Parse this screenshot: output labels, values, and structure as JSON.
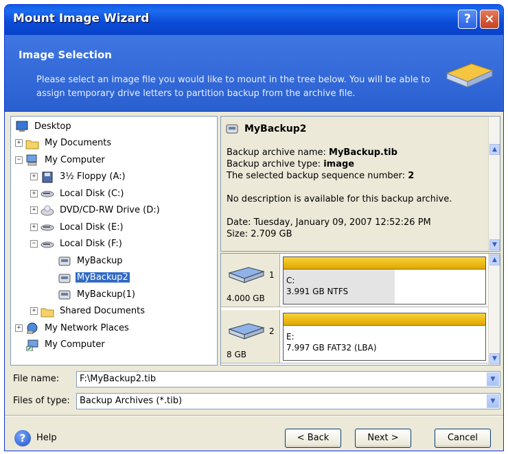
{
  "window": {
    "title": "Mount Image Wizard",
    "help_glyph": "?",
    "close_glyph": "×"
  },
  "header": {
    "title": "Image Selection",
    "description": "Please select an image file you would like to mount in the tree below. You will be able to assign temporary drive letters to partition backup from the archive file."
  },
  "tree": {
    "items": [
      {
        "label": "Desktop",
        "icon": "desktop-icon"
      },
      {
        "label": "My Documents",
        "icon": "folder-icon",
        "expander": "+"
      },
      {
        "label": "My Computer",
        "icon": "computer-icon",
        "expander": "-"
      },
      {
        "label": "3½ Floppy (A:)",
        "icon": "floppy-icon",
        "expander": "+"
      },
      {
        "label": "Local Disk (C:)",
        "icon": "hard-disk-icon",
        "expander": "+"
      },
      {
        "label": "DVD/CD-RW Drive (D:)",
        "icon": "cd-drive-icon",
        "expander": "+"
      },
      {
        "label": "Local Disk (E:)",
        "icon": "hard-disk-icon",
        "expander": "+"
      },
      {
        "label": "Local Disk (F:)",
        "icon": "hard-disk-icon",
        "expander": "-"
      },
      {
        "label": "MyBackup",
        "icon": "backup-archive-icon"
      },
      {
        "label": "MyBackup2",
        "icon": "backup-archive-icon",
        "selected": true
      },
      {
        "label": "MyBackup(1)",
        "icon": "backup-archive-icon"
      },
      {
        "label": "Shared Documents",
        "icon": "folder-icon",
        "expander": "+"
      },
      {
        "label": "My Network Places",
        "icon": "network-icon",
        "expander": "+"
      },
      {
        "label": "My Computer",
        "icon": "computer-shortcut-icon"
      }
    ]
  },
  "info": {
    "title": "MyBackup2",
    "archive_name_label": "Backup archive name: ",
    "archive_name": "MyBackup.tib",
    "archive_type_label": "Backup archive type: ",
    "archive_type": "image",
    "sequence_label": "The selected backup sequence number: ",
    "sequence": "2",
    "description": "No description is available for this backup archive.",
    "date": "Date: Tuesday, January 09, 2007 12:52:26 PM",
    "size": "Size: 2.709 GB"
  },
  "partitions": [
    {
      "disk_number": "1",
      "disk_size": "4.000 GB",
      "letter": "C:",
      "details": "3.991 GB  NTFS",
      "used_fraction": 0.55
    },
    {
      "disk_number": "2",
      "disk_size": "8 GB",
      "letter": "E:",
      "details": "7.997 GB  FAT32 (LBA)",
      "used_fraction": 0.0
    }
  ],
  "file_name": {
    "label": "File name:",
    "value": "F:\\MyBackup2.tib"
  },
  "file_type": {
    "label": "Files of type:",
    "value": "Backup Archives (*.tib)"
  },
  "footer": {
    "help_label": "Help",
    "back_label": "< Back",
    "next_label": "Next >",
    "cancel_label": "Cancel"
  },
  "colors": {
    "title_bar": "#0a5fe4",
    "header_bg": "#3f76e2",
    "selection": "#316ac5",
    "partition_bar": "#f0c020"
  }
}
